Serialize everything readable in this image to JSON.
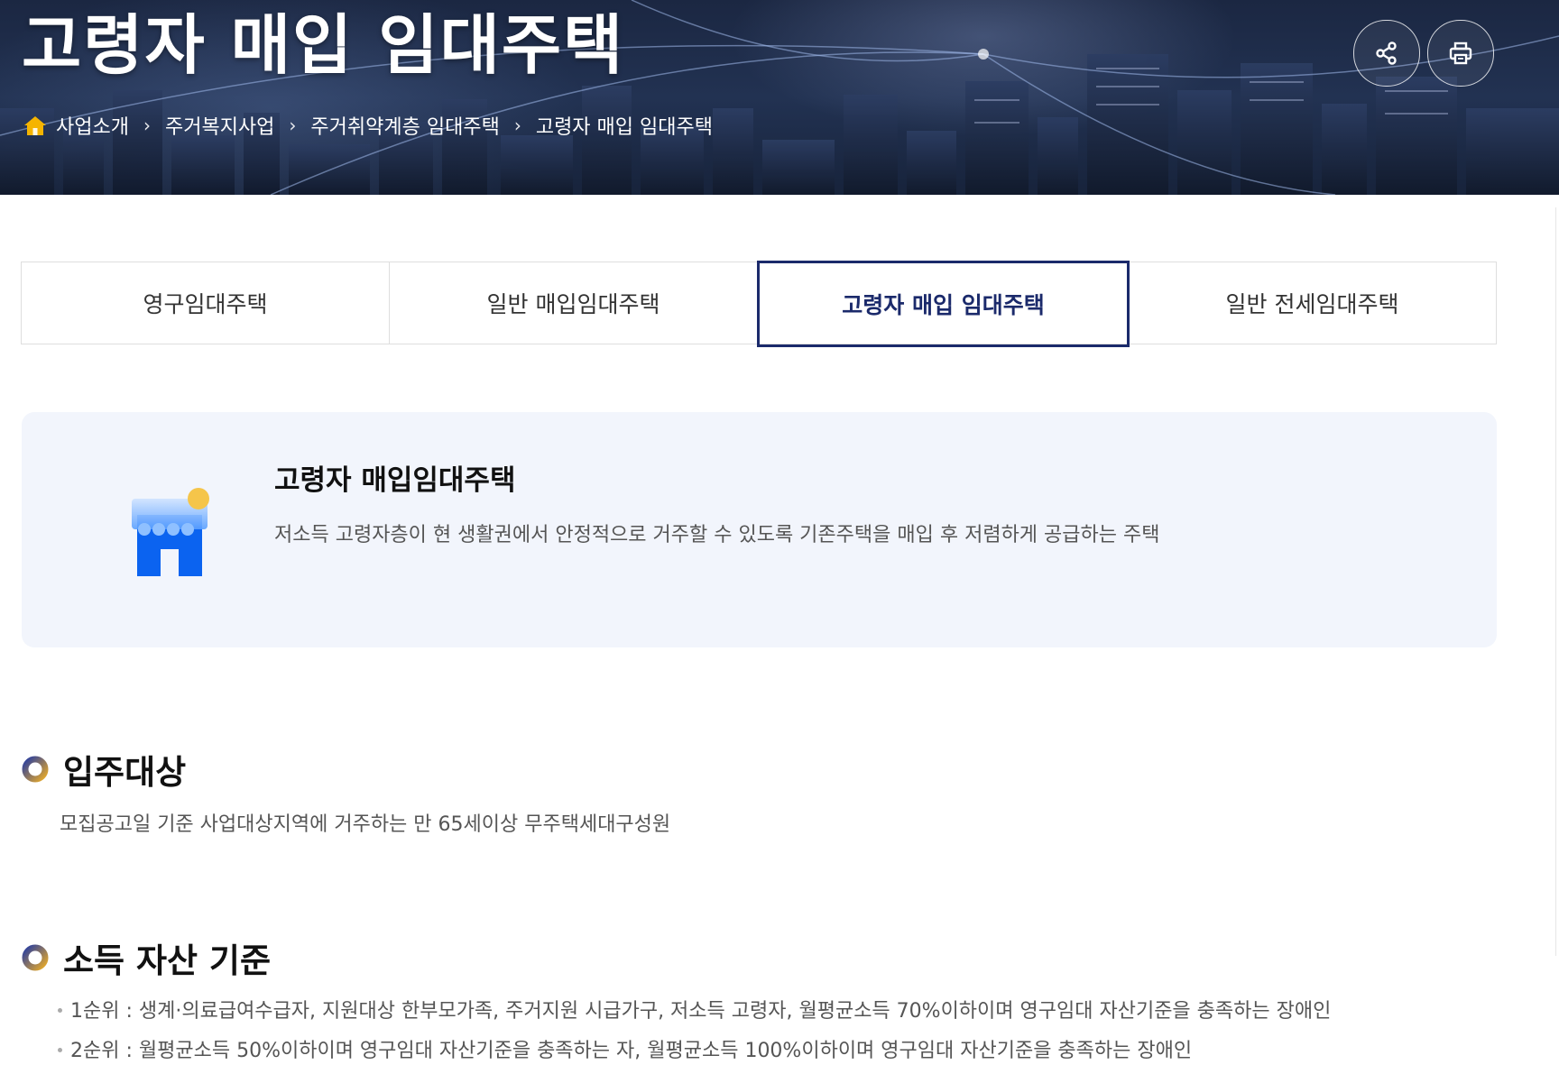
{
  "hero": {
    "title": "고령자 매입 임대주택",
    "share_label": "share",
    "print_label": "print"
  },
  "breadcrumb": [
    "사업소개",
    "주거복지사업",
    "주거취약계층 임대주택",
    "고령자 매입 임대주택"
  ],
  "tabs": [
    {
      "label": "영구임대주택",
      "active": false
    },
    {
      "label": "일반 매입임대주택",
      "active": false
    },
    {
      "label": "고령자 매입 임대주택",
      "active": true
    },
    {
      "label": "일반 전세임대주택",
      "active": false
    }
  ],
  "intro": {
    "title": "고령자 매입임대주택",
    "description": "저소득 고령자층이 현 생활권에서 안정적으로 거주할 수 있도록 기존주택을 매입 후 저렴하게 공급하는 주택",
    "icon": "store-icon"
  },
  "eligibility": {
    "title": "입주대상",
    "text": "모집공고일 기준 사업대상지역에 거주하는 만 65세이상 무주택세대구성원"
  },
  "income": {
    "title": "소득 자산 기준",
    "items": [
      "1순위 : 생계·의료급여수급자, 지원대상 한부모가족, 주거지원 시급가구, 저소득 고령자, 월평균소득 70%이하이며 영구임대 자산기준을 충족하는 장애인",
      "2순위 : 월평균소득 50%이하이며 영구임대 자산기준을 충족하는 자, 월평균소득 100%이하이며 영구임대 자산기준을 충족하는 장애인"
    ]
  },
  "colors": {
    "accent": "#1b2a6b",
    "card_bg": "#f2f5fc",
    "ring_blue": "#2b3f9e",
    "ring_gold": "#e6a92a"
  }
}
